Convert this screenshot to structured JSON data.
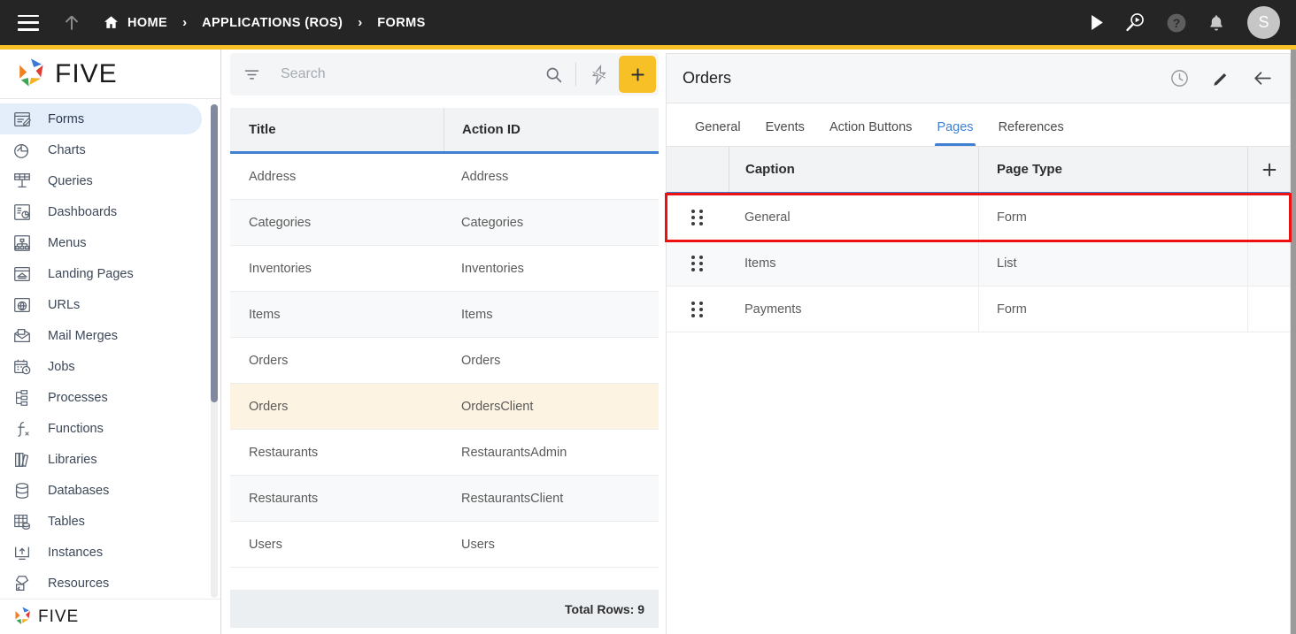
{
  "topbar": {
    "menu_icon": "hamburger-icon",
    "up_icon": "arrow-up-icon",
    "breadcrumbs": [
      {
        "label": "HOME",
        "icon": "home-icon"
      },
      {
        "label": "APPLICATIONS (ROS)",
        "icon": ""
      },
      {
        "label": "FORMS",
        "icon": ""
      }
    ],
    "separator": "›",
    "actions": [
      {
        "name": "run-icon"
      },
      {
        "name": "preview-search-icon"
      },
      {
        "name": "help-icon"
      },
      {
        "name": "notifications-bell-icon"
      }
    ],
    "avatar_initial": "S",
    "bg_color": "#252525",
    "accent_color": "#f6c026"
  },
  "sidebar": {
    "brand": "FIVE",
    "footer_brand": "FIVE",
    "active_item": "Forms",
    "items": [
      {
        "label": "Forms",
        "icon": "forms-icon"
      },
      {
        "label": "Charts",
        "icon": "charts-icon"
      },
      {
        "label": "Queries",
        "icon": "queries-icon"
      },
      {
        "label": "Dashboards",
        "icon": "dashboards-icon"
      },
      {
        "label": "Menus",
        "icon": "menus-icon"
      },
      {
        "label": "Landing Pages",
        "icon": "landing-pages-icon"
      },
      {
        "label": "URLs",
        "icon": "urls-icon"
      },
      {
        "label": "Mail Merges",
        "icon": "mail-merges-icon"
      },
      {
        "label": "Jobs",
        "icon": "jobs-icon"
      },
      {
        "label": "Processes",
        "icon": "processes-icon"
      },
      {
        "label": "Functions",
        "icon": "functions-icon"
      },
      {
        "label": "Libraries",
        "icon": "libraries-icon"
      },
      {
        "label": "Databases",
        "icon": "databases-icon"
      },
      {
        "label": "Tables",
        "icon": "tables-icon"
      },
      {
        "label": "Instances",
        "icon": "instances-icon"
      },
      {
        "label": "Resources",
        "icon": "resources-icon"
      }
    ]
  },
  "list_panel": {
    "search": {
      "placeholder": "Search",
      "value": ""
    },
    "filter_icon": "filter-icon",
    "search_icon": "search-icon",
    "quick_action_icon": "lightning-bolt-icon",
    "add_icon": "plus-icon",
    "add_button_color": "#f6c026",
    "columns": [
      "Title",
      "Action ID"
    ],
    "selected_row_index": 5,
    "rows": [
      {
        "title": "Address",
        "action_id": "Address"
      },
      {
        "title": "Categories",
        "action_id": "Categories"
      },
      {
        "title": "Inventories",
        "action_id": "Inventories"
      },
      {
        "title": "Items",
        "action_id": "Items"
      },
      {
        "title": "Orders",
        "action_id": "Orders"
      },
      {
        "title": "Orders",
        "action_id": "OrdersClient"
      },
      {
        "title": "Restaurants",
        "action_id": "RestaurantsAdmin"
      },
      {
        "title": "Restaurants",
        "action_id": "RestaurantsClient"
      },
      {
        "title": "Users",
        "action_id": "Users"
      }
    ],
    "footer": "Total Rows: 9"
  },
  "detail_panel": {
    "title": "Orders",
    "header_icons": [
      {
        "name": "history-clock-icon"
      },
      {
        "name": "edit-pencil-icon"
      },
      {
        "name": "back-arrow-icon"
      }
    ],
    "tabs": [
      {
        "label": "General",
        "active": false
      },
      {
        "label": "Events",
        "active": false
      },
      {
        "label": "Action Buttons",
        "active": false
      },
      {
        "label": "Pages",
        "active": true
      },
      {
        "label": "References",
        "active": false
      }
    ],
    "pages_grid": {
      "columns": [
        "Caption",
        "Page Type"
      ],
      "add_icon": "plus-icon",
      "drag_handle_icon": "drag-handle-icon",
      "highlighted_row_index": 0,
      "highlight_color": "#ee1111",
      "rows": [
        {
          "caption": "General",
          "page_type": "Form"
        },
        {
          "caption": "Items",
          "page_type": "List"
        },
        {
          "caption": "Payments",
          "page_type": "Form"
        }
      ]
    }
  }
}
